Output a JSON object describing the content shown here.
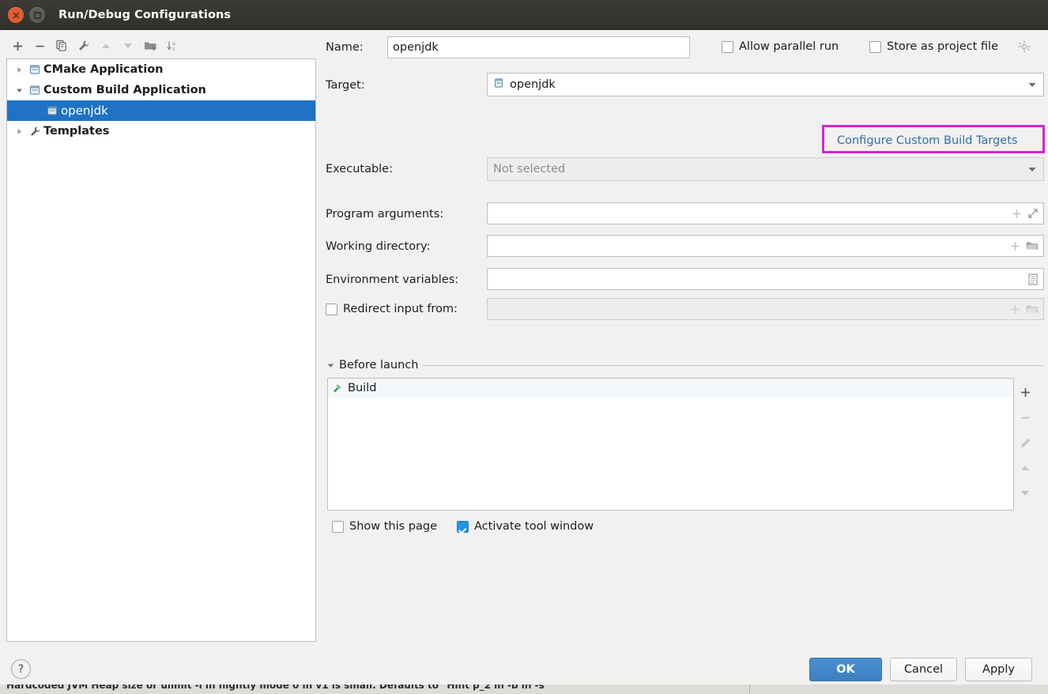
{
  "window": {
    "title": "Run/Debug Configurations",
    "close_icon": "close-icon",
    "maximize_icon": "maximize-icon"
  },
  "left_panel": {
    "toolbar": [
      {
        "name": "add-configuration-button",
        "icon": "plus-icon",
        "enabled": true
      },
      {
        "name": "remove-configuration-button",
        "icon": "minus-icon",
        "enabled": true
      },
      {
        "name": "copy-configuration-button",
        "icon": "copy-icon",
        "enabled": true
      },
      {
        "name": "edit-templates-button",
        "icon": "wrench-icon",
        "enabled": true
      },
      {
        "name": "move-up-button",
        "icon": "arrow-up-icon",
        "enabled": false
      },
      {
        "name": "move-down-button",
        "icon": "arrow-down-icon",
        "enabled": false
      },
      {
        "name": "move-into-folder-button",
        "icon": "folder-add-icon",
        "enabled": true
      },
      {
        "name": "sort-alphabetically-button",
        "icon": "sort-az-icon",
        "enabled": true
      }
    ],
    "tree": [
      {
        "label": "CMake Application",
        "level": 1,
        "expanded": false,
        "has_twisty": true,
        "icon": "run-config-icon",
        "selected": false
      },
      {
        "label": "Custom Build Application",
        "level": 1,
        "expanded": true,
        "has_twisty": true,
        "icon": "run-config-icon",
        "selected": false
      },
      {
        "label": "openjdk",
        "level": 2,
        "expanded": false,
        "has_twisty": false,
        "icon": "run-config-icon",
        "selected": true
      },
      {
        "label": "Templates",
        "level": 1,
        "expanded": false,
        "has_twisty": true,
        "icon": "wrench-icon",
        "selected": false
      }
    ]
  },
  "form": {
    "name_label": "Name:",
    "name_value": "openjdk",
    "allow_parallel_run": {
      "label": "Allow parallel run",
      "checked": false
    },
    "store_as_project_file": {
      "label": "Store as project file",
      "checked": false,
      "gear_icon": "gear-icon"
    },
    "target_label": "Target:",
    "target_value": "openjdk",
    "target_icon": "build-target-icon",
    "configure_link": "Configure Custom Build Targets",
    "executable_label": "Executable:",
    "executable_placeholder": "Not selected",
    "program_arguments_label": "Program arguments:",
    "program_arguments_value": "",
    "program_arguments_icons": [
      "plus-icon",
      "expand-icon"
    ],
    "working_directory_label": "Working directory:",
    "working_directory_value": "",
    "working_directory_icons": [
      "plus-icon",
      "folder-icon"
    ],
    "environment_variables_label": "Environment variables:",
    "environment_variables_value": "",
    "environment_variables_icons": [
      "list-edit-icon"
    ],
    "redirect_input_from": {
      "label": "Redirect input from:",
      "checked": false,
      "value": "",
      "icons": [
        "plus-icon",
        "folder-icon"
      ]
    }
  },
  "before_launch": {
    "title": "Before launch",
    "expanded": true,
    "items": [
      {
        "label": "Build",
        "icon": "build-hammer-icon"
      }
    ],
    "side_buttons": [
      {
        "name": "add-task-button",
        "icon": "plus-icon",
        "enabled": true
      },
      {
        "name": "remove-task-button",
        "icon": "minus-icon",
        "enabled": false
      },
      {
        "name": "edit-task-button",
        "icon": "pencil-icon",
        "enabled": false
      },
      {
        "name": "move-task-up-button",
        "icon": "arrow-up-icon",
        "enabled": false
      },
      {
        "name": "move-task-down-button",
        "icon": "arrow-down-icon",
        "enabled": false
      }
    ],
    "show_this_page": {
      "label": "Show this page",
      "checked": false
    },
    "activate_tool_window": {
      "label": "Activate tool window",
      "checked": true
    }
  },
  "footer": {
    "help_label": "?",
    "ok_label": "OK",
    "cancel_label": "Cancel",
    "apply_label": "Apply"
  },
  "colors": {
    "accent_blue": "#1f72c4",
    "ok_button_blue": "#3e7fc0",
    "annotation_magenta": "#d426d4",
    "link_blue": "#2f6ea8",
    "titlebar_dark": "#302f2b"
  }
}
